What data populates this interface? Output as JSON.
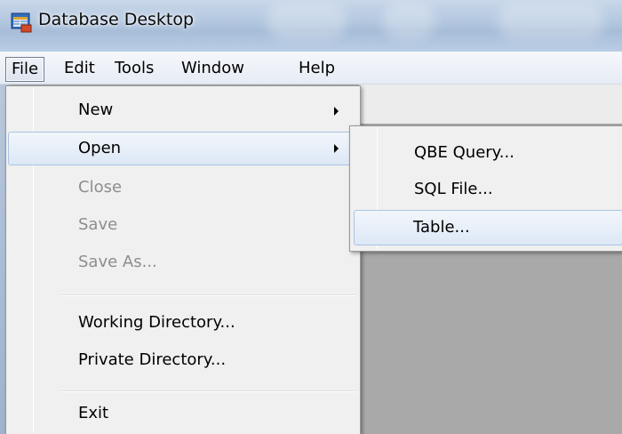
{
  "window": {
    "title": "Database Desktop",
    "icon": "database-desktop-icon"
  },
  "menubar": {
    "items": [
      {
        "label": "File"
      },
      {
        "label": "Edit"
      },
      {
        "label": "Tools"
      },
      {
        "label": "Window"
      },
      {
        "label": "Help"
      }
    ],
    "active": "File"
  },
  "file_menu": {
    "items": [
      {
        "label": "New",
        "submenu": true,
        "enabled": true
      },
      {
        "label": "Open",
        "submenu": true,
        "enabled": true,
        "highlighted": true
      },
      {
        "label": "Close",
        "enabled": false
      },
      {
        "label": "Save",
        "enabled": false
      },
      {
        "label": "Save As...",
        "enabled": false
      },
      {
        "label": "Working Directory...",
        "enabled": true
      },
      {
        "label": "Private Directory...",
        "enabled": true
      },
      {
        "label": "Exit",
        "enabled": true
      }
    ]
  },
  "open_submenu": {
    "items": [
      {
        "label": "QBE Query..."
      },
      {
        "label": "SQL File..."
      },
      {
        "label": "Table...",
        "highlighted": true
      }
    ]
  },
  "colors": {
    "menu_bg": "#f0f0f0",
    "highlight_border": "#a8c4e4",
    "disabled_text": "#8d8d8d",
    "workspace": "#a9a9a9"
  }
}
